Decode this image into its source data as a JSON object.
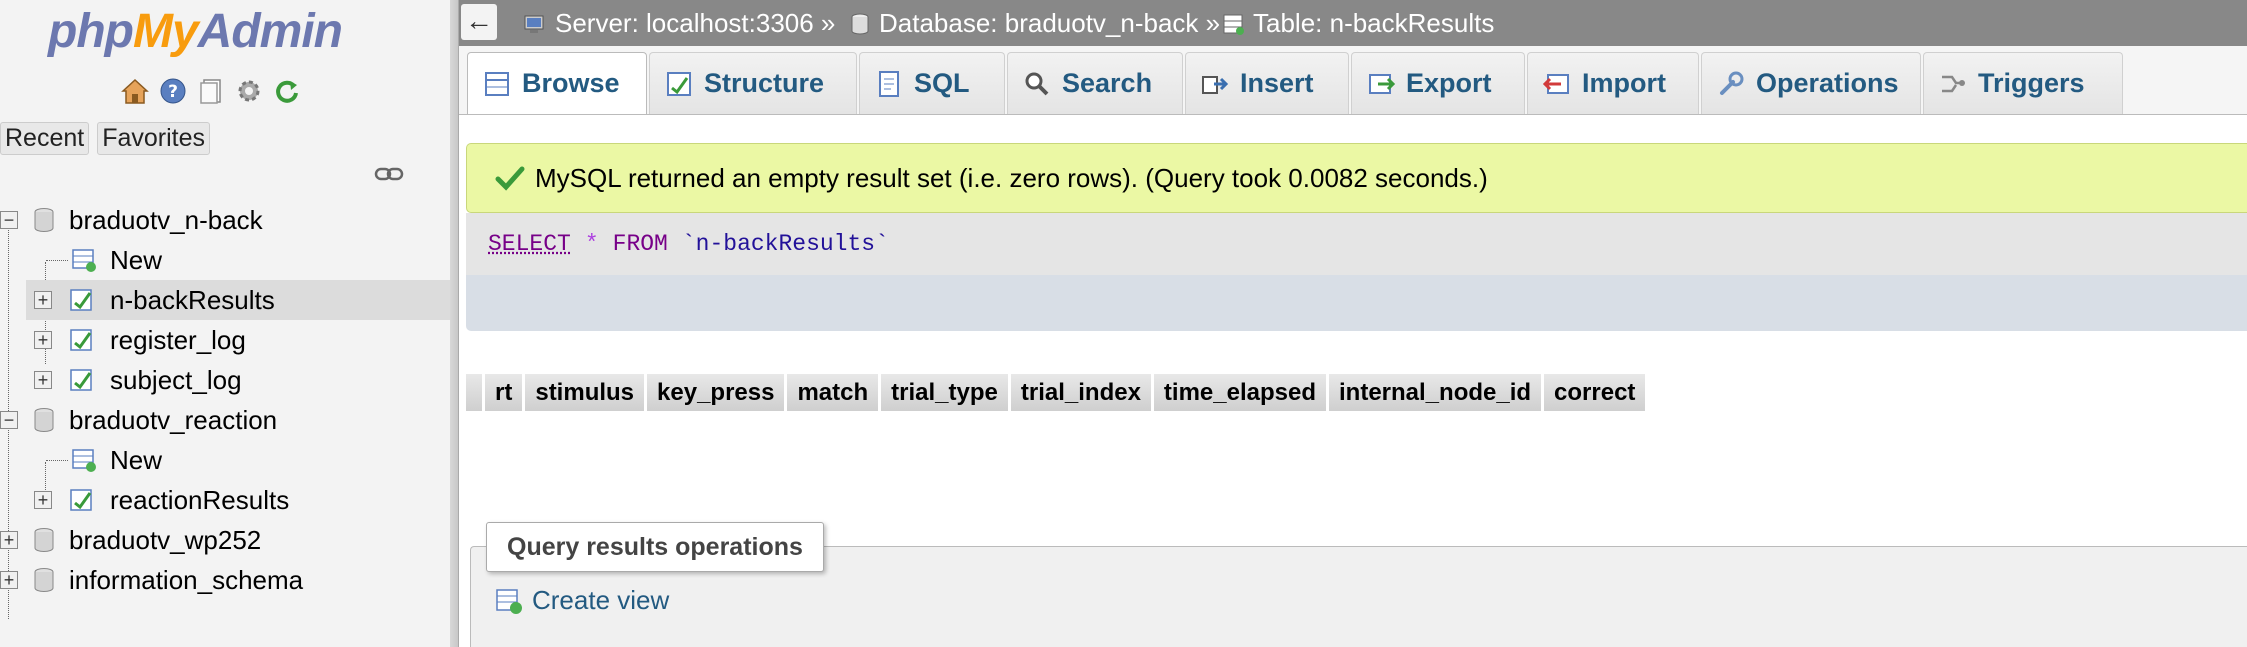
{
  "logo": {
    "part1": "php",
    "part2": "My",
    "part3": "Admin"
  },
  "nav_icons": [
    "home-icon",
    "help-icon",
    "docs-icon",
    "settings-icon",
    "reload-icon"
  ],
  "nav_tabs": {
    "recent": "Recent",
    "favorites": "Favorites"
  },
  "tree": {
    "db1": {
      "name": "braduotv_n-back",
      "new": "New",
      "tables": [
        "n-backResults",
        "register_log",
        "subject_log"
      ]
    },
    "db2": {
      "name": "braduotv_reaction",
      "new": "New",
      "tables": [
        "reactionResults"
      ]
    },
    "db3": {
      "name": "braduotv_wp252"
    },
    "db4": {
      "name": "information_schema"
    }
  },
  "breadcrumb": {
    "back": "←",
    "server": "Server: localhost:3306 »",
    "database": "Database: braduotv_n-back »",
    "table": "Table: n-backResults"
  },
  "tabs": [
    "Browse",
    "Structure",
    "SQL",
    "Search",
    "Insert",
    "Export",
    "Import",
    "Operations",
    "Triggers"
  ],
  "success_message": "MySQL returned an empty result set (i.e. zero rows). (Query took 0.0082 seconds.)",
  "sql": {
    "select": "SELECT",
    "star": "*",
    "from": "FROM",
    "table": "`n-backResults`"
  },
  "columns": [
    "rt",
    "stimulus",
    "key_press",
    "match",
    "trial_type",
    "trial_index",
    "time_elapsed",
    "internal_node_id",
    "correct"
  ],
  "query_ops": {
    "legend": "Query results operations",
    "create_view": "Create view"
  },
  "colors": {
    "link": "#235a81",
    "success_bg": "#ebf8a4",
    "topbar": "#888888"
  }
}
